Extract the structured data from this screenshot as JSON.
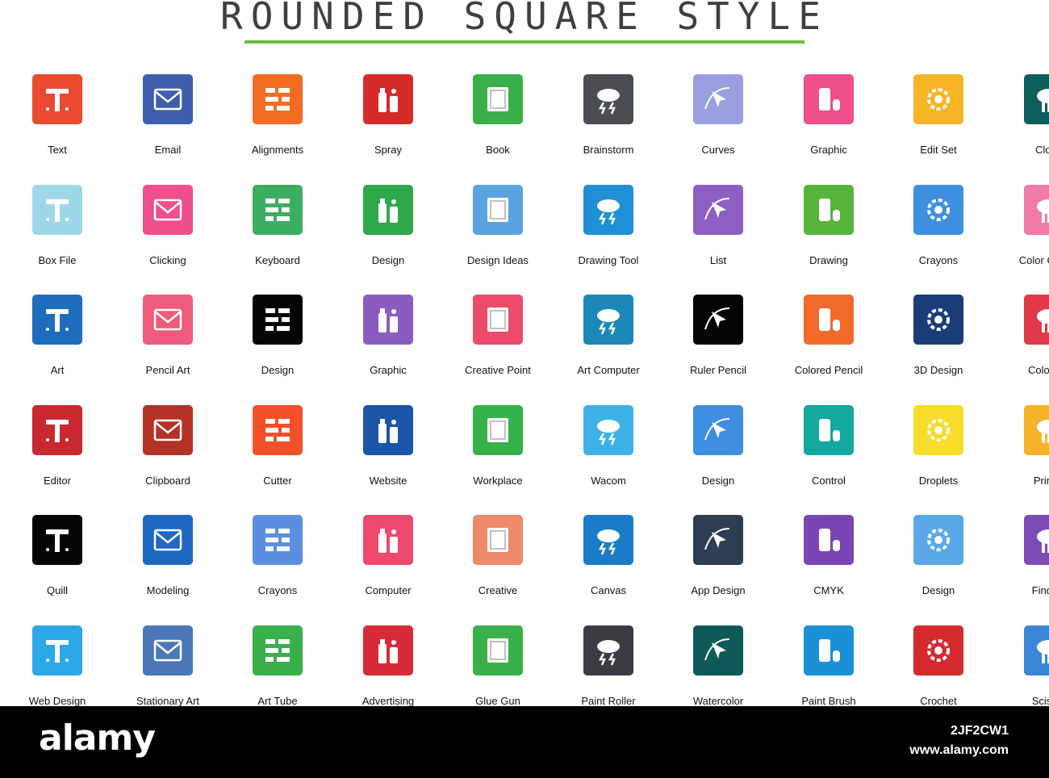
{
  "header": {
    "title": "ROUNDED SQUARE STYLE"
  },
  "colors": {
    "accent_rule": "#6dbb45",
    "footer_bg": "#000000"
  },
  "rows": [
    [
      {
        "label": "Text",
        "color": "#ea4a2f",
        "icon": "text-tool-icon"
      },
      {
        "label": "Email",
        "color": "#3d5fae",
        "icon": "envelope-icon"
      },
      {
        "label": "Alignments",
        "color": "#f26d23",
        "icon": "grid-blocks-icon"
      },
      {
        "label": "Spray",
        "color": "#d62a2a",
        "icon": "spray-can-icon"
      },
      {
        "label": "Book",
        "color": "#3bb04a",
        "icon": "book-icon"
      },
      {
        "label": "Brainstorm",
        "color": "#4a4d52",
        "icon": "storm-cloud-icon"
      },
      {
        "label": "Curves",
        "color": "#9b9fe0",
        "icon": "cursor-curve-icon"
      },
      {
        "label": "Graphic",
        "color": "#ef4f8a",
        "icon": "pen-mouse-icon"
      },
      {
        "label": "Edit Set",
        "color": "#f6b427",
        "icon": "gear-target-icon"
      },
      {
        "label": "Cloud",
        "color": "#0c5f5b",
        "icon": "cloud-tools-icon"
      }
    ],
    [
      {
        "label": "Box File",
        "color": "#9ed8e8",
        "icon": "box-file-icon"
      },
      {
        "label": "Clicking",
        "color": "#ef4f8a",
        "icon": "hand-click-icon"
      },
      {
        "label": "Keyboard",
        "color": "#3cae5f",
        "icon": "keyboard-icon"
      },
      {
        "label": "Design",
        "color": "#2ea84a",
        "icon": "monitor-pens-icon"
      },
      {
        "label": "Design Ideas",
        "color": "#5aa3e0",
        "icon": "mouse-leaf-icon"
      },
      {
        "label": "Drawing Tool",
        "color": "#1f8fd6",
        "icon": "compass-ruler-icon"
      },
      {
        "label": "List",
        "color": "#8d5fc2",
        "icon": "list-pen-icon"
      },
      {
        "label": "Drawing",
        "color": "#56b33c",
        "icon": "pinwheel-icon"
      },
      {
        "label": "Crayons",
        "color": "#3d8fe0",
        "icon": "crayon-box-icon"
      },
      {
        "label": "Color Circles",
        "color": "#f07aa8",
        "icon": "color-circles-icon"
      }
    ],
    [
      {
        "label": "Art",
        "color": "#1e6ebd",
        "icon": "crossed-tools-icon"
      },
      {
        "label": "Pencil Art",
        "color": "#ee5b7c",
        "icon": "bulb-pencil-icon"
      },
      {
        "label": "Design",
        "color": "#050505",
        "icon": "design-board-icon"
      },
      {
        "label": "Graphic",
        "color": "#8a5cc2",
        "icon": "gear-compass-icon"
      },
      {
        "label": "Creative Point",
        "color": "#ee4a6a",
        "icon": "pen-nib-icon"
      },
      {
        "label": "Art Computer",
        "color": "#1b88b8",
        "icon": "laptop-leaf-icon"
      },
      {
        "label": "Ruler Pencil",
        "color": "#050505",
        "icon": "ruler-pencil-icon"
      },
      {
        "label": "Colored Pencil",
        "color": "#f26a2a",
        "icon": "pencil-cup-icon"
      },
      {
        "label": "3D Design",
        "color": "#1a3d78",
        "icon": "cube-3d-icon"
      },
      {
        "label": "Color Ink",
        "color": "#e03a4a",
        "icon": "ink-bottles-icon"
      }
    ],
    [
      {
        "label": "Editor",
        "color": "#c8282e",
        "icon": "editor-screen-icon"
      },
      {
        "label": "Clipboard",
        "color": "#b43226",
        "icon": "easel-board-icon"
      },
      {
        "label": "Cutter",
        "color": "#f1502a",
        "icon": "cutter-icon"
      },
      {
        "label": "Website",
        "color": "#1c55a8",
        "icon": "website-monitor-icon"
      },
      {
        "label": "Workplace",
        "color": "#35b249",
        "icon": "desk-icon"
      },
      {
        "label": "Wacom",
        "color": "#3eb2e6",
        "icon": "tablet-pen-icon"
      },
      {
        "label": "Design",
        "color": "#3f8ee0",
        "icon": "pyramid-icon"
      },
      {
        "label": "Control",
        "color": "#13a8a0",
        "icon": "sliders-icon"
      },
      {
        "label": "Droplets",
        "color": "#f7dc2a",
        "icon": "droplets-icon"
      },
      {
        "label": "Printer",
        "color": "#f6b32a",
        "icon": "printer-icon"
      }
    ],
    [
      {
        "label": "Quill",
        "color": "#050505",
        "icon": "quill-ink-icon"
      },
      {
        "label": "Modeling",
        "color": "#1e68c4",
        "icon": "laptop-cube-icon"
      },
      {
        "label": "Crayons",
        "color": "#5a8fe0",
        "icon": "crayons-icon"
      },
      {
        "label": "Computer",
        "color": "#ee4a6e",
        "icon": "computer-layout-icon"
      },
      {
        "label": "Creative",
        "color": "#ee8a6a",
        "icon": "head-bulb-icon"
      },
      {
        "label": "Canvas",
        "color": "#1a7cc6",
        "icon": "canvas-easel-icon"
      },
      {
        "label": "App Design",
        "color": "#2d3d52",
        "icon": "phone-design-icon"
      },
      {
        "label": "CMYK",
        "color": "#7a46b6",
        "icon": "cmyk-monitor-icon"
      },
      {
        "label": "Design",
        "color": "#5aa8e8",
        "icon": "browser-pen-icon"
      },
      {
        "label": "Finding",
        "color": "#7d4bb8",
        "icon": "box-search-icon"
      }
    ],
    [
      {
        "label": "Web Design",
        "color": "#2ba8e8",
        "icon": "web-brush-icon"
      },
      {
        "label": "Stationary Art",
        "color": "#4a78b8",
        "icon": "laptop-stationery-icon"
      },
      {
        "label": "Art Tube",
        "color": "#3ab04a",
        "icon": "paint-tube-icon"
      },
      {
        "label": "Advertising",
        "color": "#d82a38",
        "icon": "eye-monitor-icon"
      },
      {
        "label": "Glue Gun",
        "color": "#3ab04a",
        "icon": "glue-gun-icon"
      },
      {
        "label": "Paint Roller",
        "color": "#3a3c42",
        "icon": "paint-roller-icon"
      },
      {
        "label": "Watercolor",
        "color": "#0e5a58",
        "icon": "watercolor-palette-icon"
      },
      {
        "label": "Paint Brush",
        "color": "#1a90d8",
        "icon": "paint-brush-icon"
      },
      {
        "label": "Crochet",
        "color": "#d62a2e",
        "icon": "crochet-hooks-icon"
      },
      {
        "label": "Scissor",
        "color": "#3a86d6",
        "icon": "scissor-icon"
      }
    ]
  ],
  "footer": {
    "brand": "alamy",
    "image_id": "2JF2CW1",
    "url": "www.alamy.com"
  }
}
